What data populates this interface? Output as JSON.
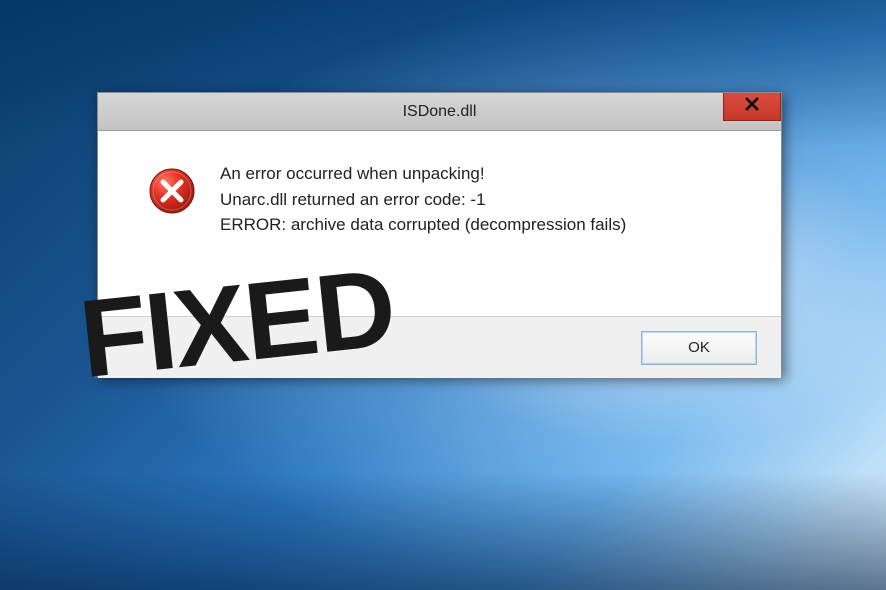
{
  "dialog": {
    "title": "ISDone.dll",
    "close_label": "Close",
    "error_line1": "An error occurred when unpacking!",
    "error_line2": "Unarc.dll returned an error code: -1",
    "error_line3": "ERROR: archive data corrupted (decompression fails)",
    "ok_label": "OK"
  },
  "overlay": {
    "fixed_text": "FIXED"
  }
}
